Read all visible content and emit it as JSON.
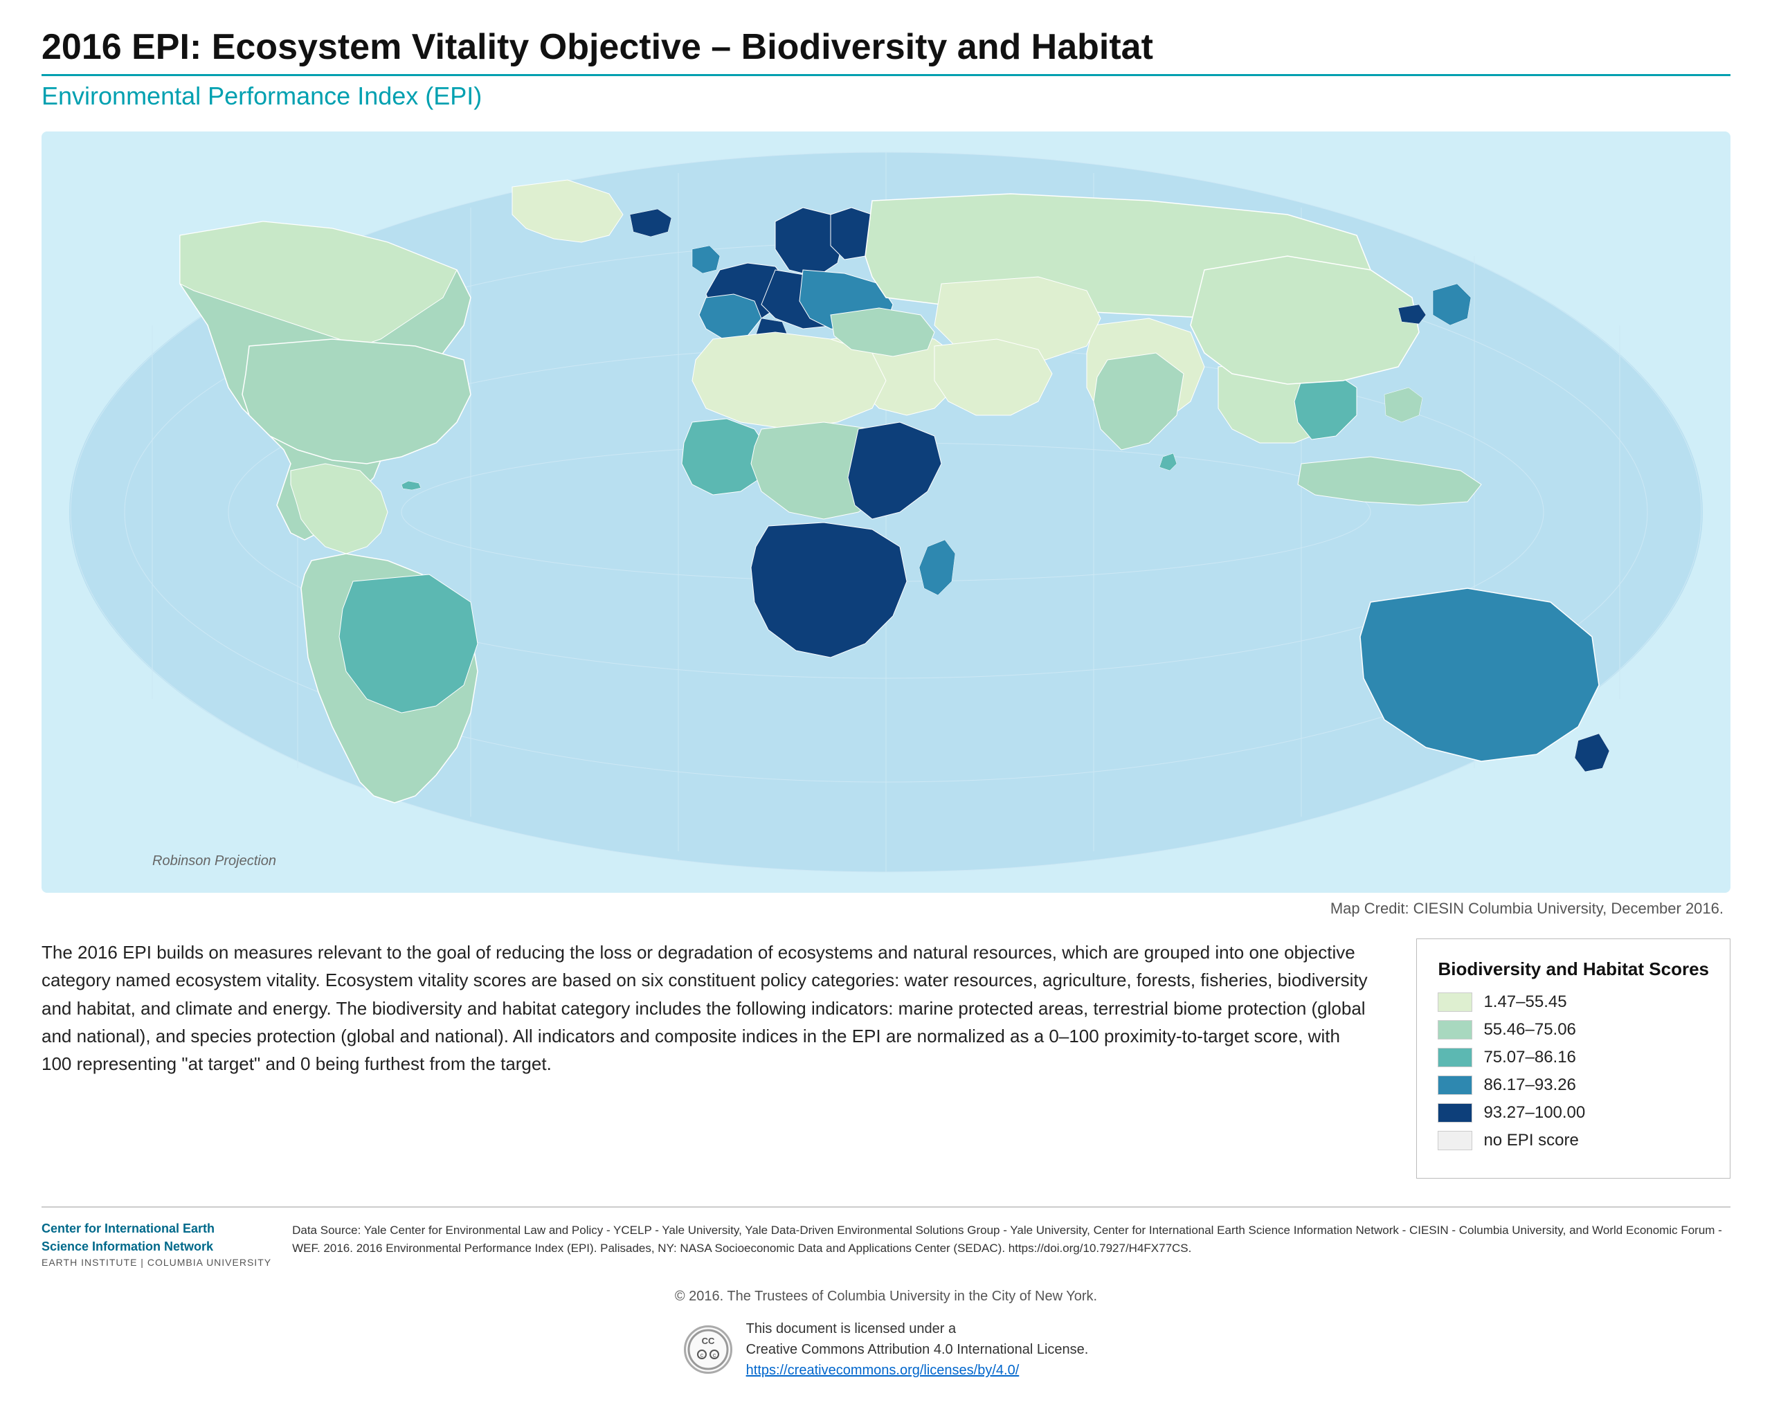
{
  "header": {
    "main_title": "2016 EPI: Ecosystem Vitality Objective – Biodiversity and Habitat",
    "subtitle": "Environmental Performance Index (EPI)"
  },
  "map": {
    "robinson_label": "Robinson Projection",
    "credit": "Map Credit: CIESIN Columbia University, December 2016."
  },
  "description": "The 2016 EPI builds on measures relevant to the goal of reducing the loss or degradation of ecosystems and natural resources, which are grouped into one objective category named ecosystem vitality. Ecosystem vitality scores are based on six constituent policy categories: water resources, agriculture, forests, fisheries, biodiversity and habitat, and climate and energy. The biodiversity and habitat category includes the following indicators: marine protected areas, terrestrial biome protection (global and national), and species protection (global and national). All indicators and composite indices in the EPI are normalized as a 0–100 proximity-to-target score, with 100 representing \"at target\" and 0 being furthest from the target.",
  "legend": {
    "title": "Biodiversity and Habitat Scores",
    "items": [
      {
        "label": "1.47–55.45",
        "color": "#deefd0"
      },
      {
        "label": "55.46–75.06",
        "color": "#a8d8bf"
      },
      {
        "label": "75.07–86.16",
        "color": "#5cb8b2"
      },
      {
        "label": "86.17–93.26",
        "color": "#2e88b0"
      },
      {
        "label": "93.27–100.00",
        "color": "#0d3f7a"
      },
      {
        "label": "no EPI score",
        "color": "#f0f0f0"
      }
    ]
  },
  "org": {
    "name1": "Center for International Earth",
    "name2": "Science Information Network",
    "name3": "EARTH INSTITUTE | COLUMBIA UNIVERSITY"
  },
  "footer": {
    "data_source": "Data Source: Yale Center for Environmental Law and Policy - YCELP - Yale University, Yale Data-Driven Environmental Solutions Group - Yale University, Center for International Earth Science Information Network - CIESIN - Columbia University, and World Economic Forum - WEF. 2016. 2016 Environmental Performance Index (EPI). Palisades, NY: NASA Socioeconomic Data and Applications Center (SEDAC). https://doi.org/10.7927/H4FX77CS.",
    "copyright": "© 2016. The Trustees of Columbia University in the City of New York.",
    "cc_text_line1": "This document is licensed under a",
    "cc_text_line2": "Creative Commons Attribution 4.0 International License.",
    "cc_link": "https://creativecommons.org/licenses/by/4.0/"
  }
}
